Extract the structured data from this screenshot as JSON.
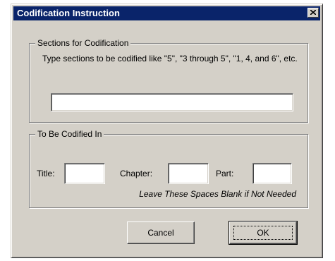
{
  "dialog": {
    "title": "Codification Instruction",
    "close_icon": "close-icon"
  },
  "sections_group": {
    "legend": "Sections for Codification",
    "instructions": "Type sections to be codified like \"5\", \"3 through 5\", \"1, 4, and 6\", etc.",
    "sections_value": ""
  },
  "codified_group": {
    "legend": "To Be Codified In",
    "title_label": "Title:",
    "title_value": "",
    "chapter_label": "Chapter:",
    "chapter_value": "",
    "part_label": "Part:",
    "part_value": "",
    "hint": "Leave These Spaces Blank if Not Needed"
  },
  "buttons": {
    "cancel": "Cancel",
    "ok": "OK"
  },
  "colors": {
    "titlebar": "#0a246a",
    "face": "#d4d0c8"
  }
}
